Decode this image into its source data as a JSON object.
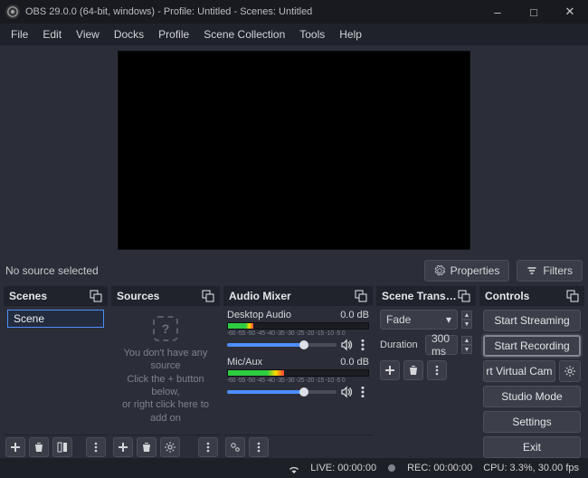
{
  "window": {
    "title": "OBS 29.0.0 (64-bit, windows) - Profile: Untitled - Scenes: Untitled"
  },
  "menu": [
    "File",
    "Edit",
    "View",
    "Docks",
    "Profile",
    "Scene Collection",
    "Tools",
    "Help"
  ],
  "preview": {
    "no_source_text": "No source selected",
    "properties_btn": "Properties",
    "filters_btn": "Filters"
  },
  "docks": {
    "scenes": {
      "title": "Scenes",
      "items": [
        "Scene"
      ]
    },
    "sources": {
      "title": "Sources",
      "empty_line1": "You don't have any source",
      "empty_line2": "Click the + button below,",
      "empty_line3": "or right click here to add on"
    },
    "mixer": {
      "title": "Audio Mixer",
      "scale_text": "-60 -55 -50 -45 -40 -35 -30 -25 -20 -15 -10 -5  0",
      "channels": [
        {
          "name": "Desktop Audio",
          "level": "0.0 dB",
          "meter_pct": 18
        },
        {
          "name": "Mic/Aux",
          "level": "0.0 dB",
          "meter_pct": 40
        }
      ]
    },
    "transitions": {
      "title": "Scene Transiti...",
      "selected": "Fade",
      "duration_label": "Duration",
      "duration_value": "300 ms"
    },
    "controls": {
      "title": "Controls",
      "start_streaming": "Start Streaming",
      "start_recording": "Start Recording",
      "virtual_cam": "rt Virtual Cam",
      "studio_mode": "Studio Mode",
      "settings": "Settings",
      "exit": "Exit"
    }
  },
  "status": {
    "live": "LIVE: 00:00:00",
    "rec": "REC: 00:00:00",
    "cpu": "CPU: 3.3%, 30.00 fps"
  }
}
